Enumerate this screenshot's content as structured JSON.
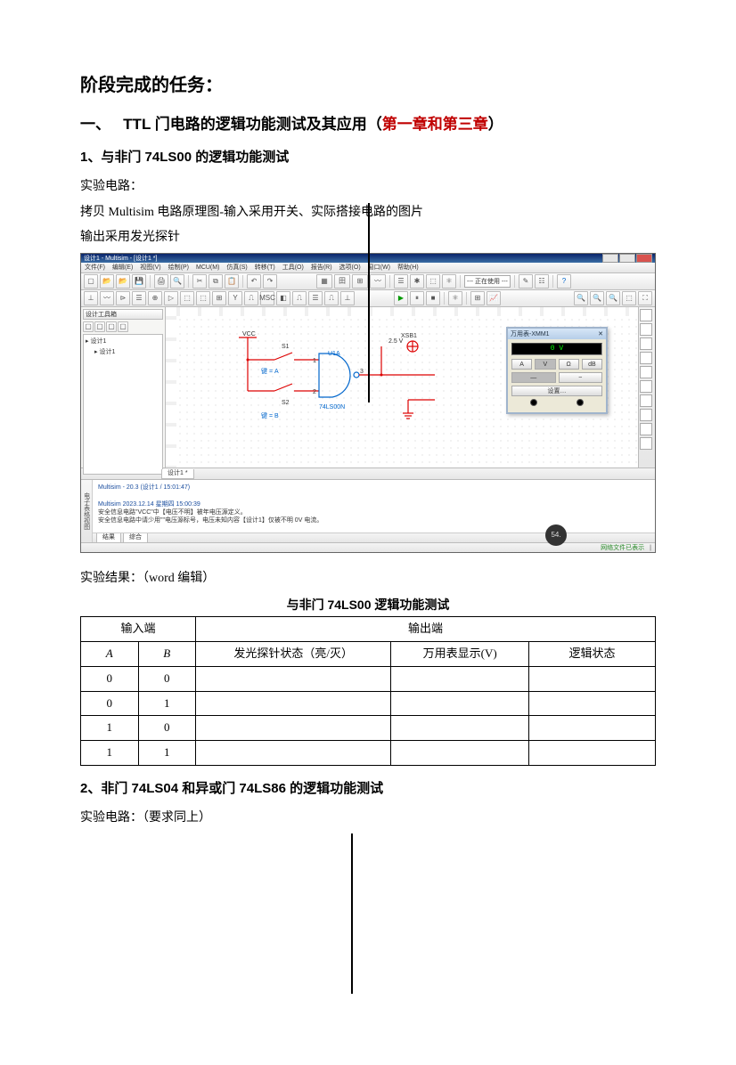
{
  "title": "阶段完成的任务：",
  "h1_prefix": "一、",
  "h1_text": "TTL 门电路的逻辑功能测试及其应用（",
  "h1_red": "第一章和第三章",
  "h1_suffix": "）",
  "sec1_h": "1、与非门 74LS00 的逻辑功能测试",
  "sec1_p1": "实验电路：",
  "sec1_p2": "拷贝 Multisim 电路原理图-输入采用开关、实际搭接电路的图片",
  "sec1_p3": "输出采用发光探针",
  "result_label": "实验结果：（word 编辑）",
  "table_title": "与非门 74LS00 逻辑功能测试",
  "table": {
    "head_in": "输入端",
    "head_out": "输出端",
    "colA": "A",
    "colB": "B",
    "col_probe": "发光探针状态（亮/灭）",
    "col_meter": "万用表显示(V)",
    "col_logic": "逻辑状态",
    "rows": [
      {
        "a": "0",
        "b": "0",
        "probe": "",
        "meter": "",
        "logic": ""
      },
      {
        "a": "0",
        "b": "1",
        "probe": "",
        "meter": "",
        "logic": ""
      },
      {
        "a": "1",
        "b": "0",
        "probe": "",
        "meter": "",
        "logic": ""
      },
      {
        "a": "1",
        "b": "1",
        "probe": "",
        "meter": "",
        "logic": ""
      }
    ]
  },
  "sec2_h": "2、非门 74LS04 和异或门 74LS86 的逻辑功能测试",
  "sec2_p1": "实验电路：（要求同上）",
  "multisim": {
    "window_title": "设计1 - Multisim - [设计1 *]",
    "menu": [
      "文件(F)",
      "编辑(E)",
      "视图(V)",
      "绘制(P)",
      "MCU(M)",
      "仿真(S)",
      "转移(T)",
      "工具(O)",
      "报告(R)",
      "选项(O)",
      "窗口(W)",
      "帮助(H)"
    ],
    "sidebar_top": "设计工具箱",
    "tree_root": "设计1",
    "tree_child": "设计1",
    "dropdown": "--- 正在使用 ---",
    "canvas_labels": {
      "vcc": "VCC",
      "s1": "S1",
      "s2": "S2",
      "keyA": "键 = A",
      "keyB": "键 = B",
      "u1a": "U1A",
      "chip": "74LS00N",
      "led": "XSB1",
      "led_v": "2.5 V",
      "n1": "1",
      "n2": "2",
      "n3": "3"
    },
    "meter": {
      "title": "万用表-XMM1",
      "display": "0 V",
      "buttons": [
        "A",
        "V",
        "Ω",
        "dB"
      ],
      "mode": [
        "—",
        "~"
      ],
      "set": "设置…"
    },
    "lower": {
      "l1": "Multisim - 20.3 (设计1 / 15:01:47)",
      "l2": "Multisim 2023.12.14 星期四 15:00:39",
      "l3": "安全信息电路\"VCC\"中【电压不明】被年电压源定义。",
      "l4": "安全信息电路中请少用\"\"电压源标号，电压未知内容【设计1】仅被不明 0V 电流。"
    },
    "lower_tabs": [
      "结果",
      "综合"
    ],
    "bottom_tab": "设计1 *",
    "status": "网络文件已表示",
    "badge": "54."
  }
}
